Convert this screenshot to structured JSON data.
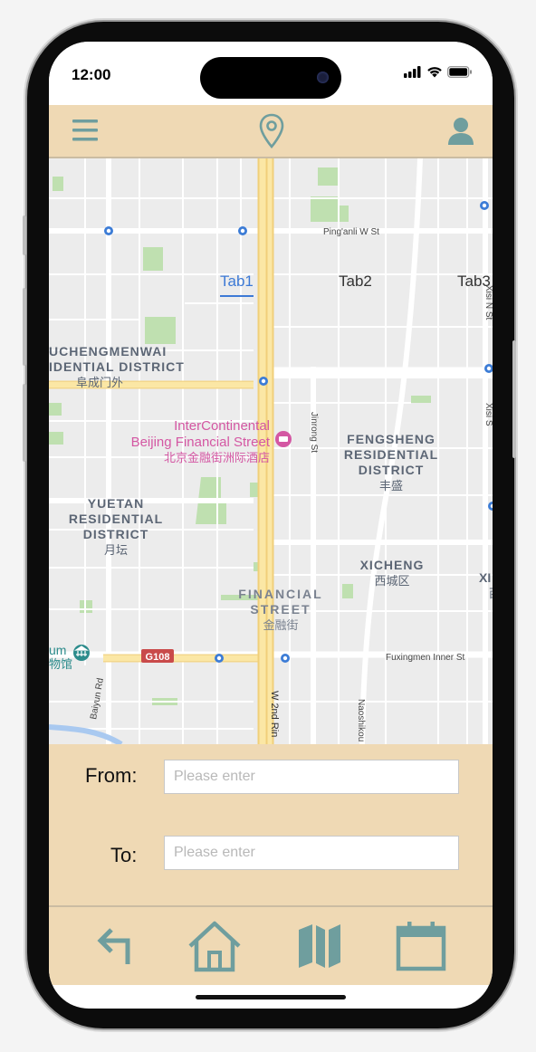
{
  "status_bar": {
    "time": "12:00"
  },
  "header": {
    "menu_icon": "hamburger-menu-icon",
    "center_icon": "location-pin-icon",
    "profile_icon": "user-icon",
    "accent_color": "#6f9e9e"
  },
  "tabs": [
    {
      "label": "Tab1",
      "active": true
    },
    {
      "label": "Tab2",
      "active": false
    },
    {
      "label": "Tab3",
      "active": false
    }
  ],
  "map": {
    "labels": {
      "pinganli": "Ping'anli W St",
      "fuchengmenwai_en1": "UCHENGMENWAI",
      "fuchengmenwai_en2": "IDENTIAL DISTRICT",
      "fuchengmenwai_zh": "阜成门外",
      "hotel_en1": "InterContinental",
      "hotel_en2": "Beijing Financial Street",
      "hotel_zh": "北京金融街洲际酒店",
      "jinrong": "Jinrong St",
      "fengsheng_en1": "FENGSHENG",
      "fengsheng_en2": "RESIDENTIAL",
      "fengsheng_en3": "DISTRICT",
      "fengsheng_zh": "丰盛",
      "yuetan_en1": "YUETAN",
      "yuetan_en2": "RESIDENTIAL",
      "yuetan_en3": "DISTRICT",
      "yuetan_zh": "月坛",
      "xicheng_en": "XICHENG",
      "xicheng_zh": "西城区",
      "financial_en1": "FINANCIAL",
      "financial_en2": "STREET",
      "financial_zh": "金融街",
      "museum_en": "um",
      "museum_zh": "物馆",
      "g108": "G108",
      "fuxingmen": "Fuxingmen Inner St",
      "baiyun": "Baiyun Rd",
      "w2ndring": "W 2nd Rin",
      "naoshikou": "Naoshikou S",
      "xisi": "Xisi N St",
      "xisi2": "Xisi S",
      "xi_edge": "XI",
      "xi_edge_zh": "西"
    }
  },
  "form": {
    "from_label": "From:",
    "to_label": "To:",
    "from_placeholder": "Please enter",
    "to_placeholder": "Please enter",
    "from_value": "",
    "to_value": ""
  },
  "bottom_nav": [
    {
      "icon": "back-arrow-icon"
    },
    {
      "icon": "home-icon"
    },
    {
      "icon": "map-icon"
    },
    {
      "icon": "calendar-icon"
    }
  ]
}
